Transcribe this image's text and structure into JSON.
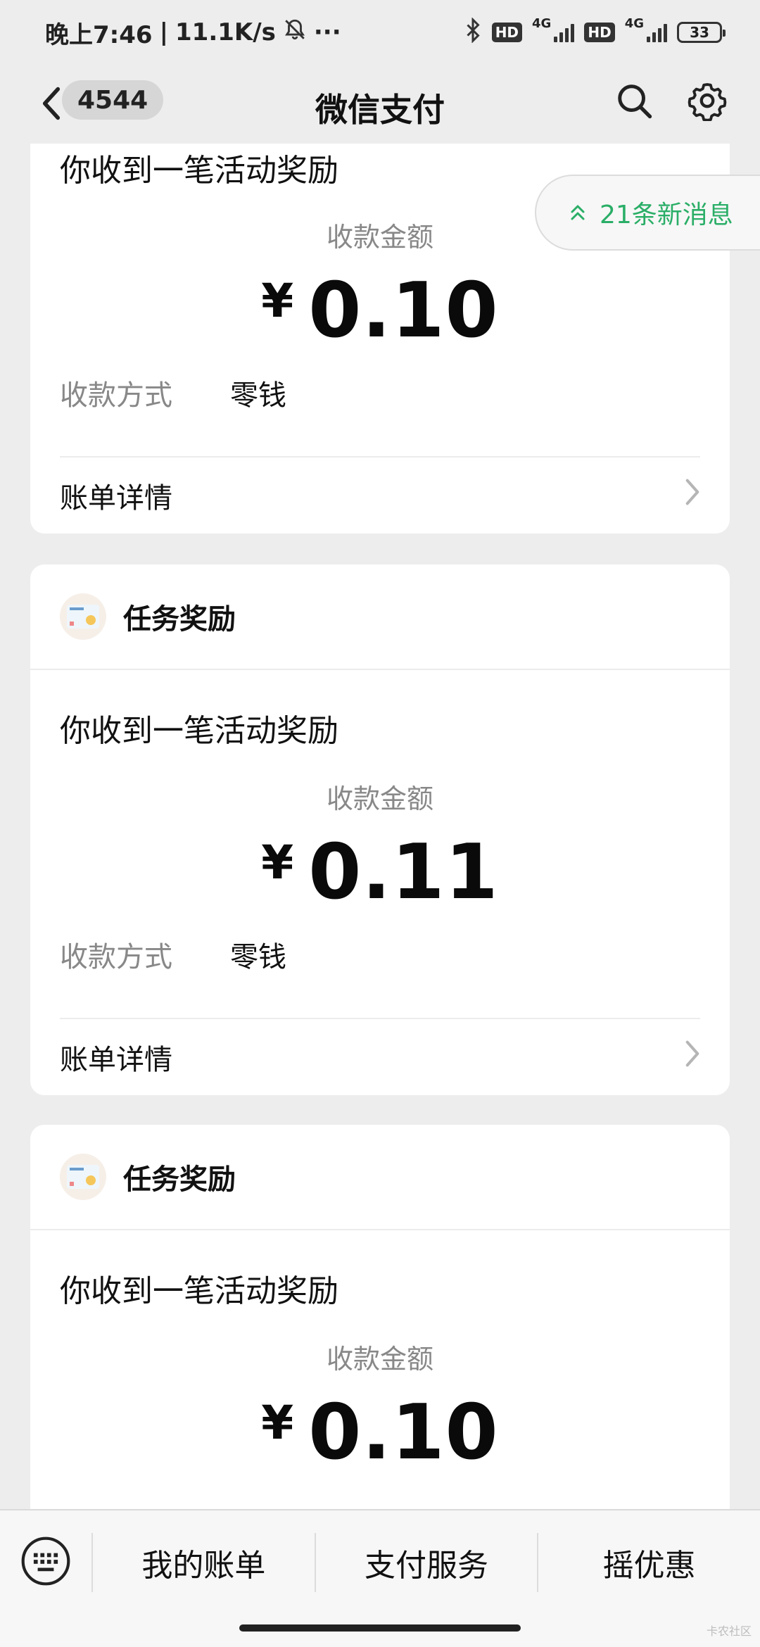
{
  "status_bar": {
    "time": "晚上7:46",
    "separator": "|",
    "speed": "11.1K/s",
    "more": "···",
    "hd1": "HD",
    "net1": "4G",
    "hd2": "HD",
    "net2": "4G",
    "battery": "33"
  },
  "nav": {
    "unread_count": "4544",
    "title": "微信支付"
  },
  "new_messages": "21条新消息",
  "cards": [
    {
      "app_name": "",
      "message_title": "你收到一笔活动奖励",
      "amount_label": "收款金额",
      "currency": "¥",
      "amount": "0.10",
      "method_label": "收款方式",
      "method_value": "零钱",
      "detail_label": "账单详情"
    },
    {
      "app_name": "任务奖励",
      "message_title": "你收到一笔活动奖励",
      "amount_label": "收款金额",
      "currency": "¥",
      "amount": "0.11",
      "method_label": "收款方式",
      "method_value": "零钱",
      "detail_label": "账单详情"
    },
    {
      "app_name": "任务奖励",
      "message_title": "你收到一笔活动奖励",
      "amount_label": "收款金额",
      "currency": "¥",
      "amount": "0.10",
      "method_label": "",
      "method_value": "",
      "detail_label": ""
    }
  ],
  "bottom_menu": {
    "items": [
      "我的账单",
      "支付服务",
      "摇优惠"
    ]
  },
  "watermark": "卡农社区",
  "icons": {
    "back": "chevron-left-icon",
    "search": "search-icon",
    "settings": "gear-icon",
    "keyboard": "keyboard-icon",
    "chevron": "chevron-right-icon",
    "arrows": "double-chevron-up-icon"
  },
  "colors": {
    "background": "#ededed",
    "accent_green": "#2aae67",
    "card": "#ffffff"
  }
}
